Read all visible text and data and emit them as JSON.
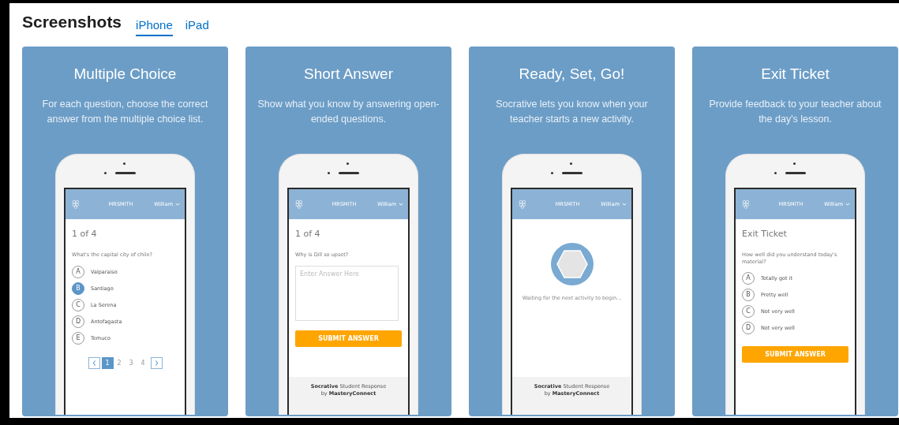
{
  "header": {
    "title": "Screenshots"
  },
  "tabs": [
    {
      "label": "iPhone",
      "selected": true
    },
    {
      "label": "iPad",
      "selected": false
    }
  ],
  "cards": [
    {
      "title": "Multiple Choice",
      "description": "For each question, choose the correct answer from the multiple choice list.",
      "phone": {
        "kind": "choice",
        "class_name": "MRSMITH",
        "user": "William",
        "heading": "1 of 4",
        "question": "What's the capital city of chile?",
        "options": [
          {
            "letter": "A",
            "text": "Valparaiso",
            "selected": false
          },
          {
            "letter": "B",
            "text": "Santiago",
            "selected": true
          },
          {
            "letter": "C",
            "text": "La Serena",
            "selected": false
          },
          {
            "letter": "D",
            "text": "Antofagasta",
            "selected": false
          },
          {
            "letter": "E",
            "text": "Temuco",
            "selected": false
          }
        ],
        "pages": [
          {
            "label": "1",
            "selected": true
          },
          {
            "label": "2",
            "selected": false
          },
          {
            "label": "3",
            "selected": false
          },
          {
            "label": "4",
            "selected": false
          }
        ]
      }
    },
    {
      "title": "Short Answer",
      "description": "Show what you know by answering open-ended questions.",
      "phone": {
        "kind": "short",
        "class_name": "MRSMITH",
        "user": "William",
        "heading": "1 of 4",
        "question": "Why is Dill so upset?",
        "placeholder": "Enter Answer Here",
        "button": "SUBMIT ANSWER",
        "footer_lines": [
          "**Socrative** Student Response",
          "by **MasteryConnect**"
        ]
      }
    },
    {
      "title": "Ready, Set, Go!",
      "description": "Socrative lets you know when your teacher starts a new activity.",
      "phone": {
        "kind": "waiting",
        "class_name": "MRSMITH",
        "user": "William",
        "message": "Waiting for the next activity to begin...",
        "footer_lines": [
          "**Socrative** Student Response",
          "by **MasteryConnect**"
        ]
      }
    },
    {
      "title": "Exit Ticket",
      "description": "Provide feedback to your teacher about the day's lesson.",
      "phone": {
        "kind": "exit",
        "class_name": "MRSMITH",
        "user": "William",
        "heading": "Exit Ticket",
        "question": "How well did you understand today's material?",
        "options": [
          {
            "letter": "A",
            "text": "Totally got it",
            "selected": false
          },
          {
            "letter": "B",
            "text": "Pretty well",
            "selected": false
          },
          {
            "letter": "C",
            "text": "Not very well",
            "selected": false
          },
          {
            "letter": "D",
            "text": "Not very well",
            "selected": false
          }
        ],
        "button": "SUBMIT ANSWER"
      }
    }
  ]
}
